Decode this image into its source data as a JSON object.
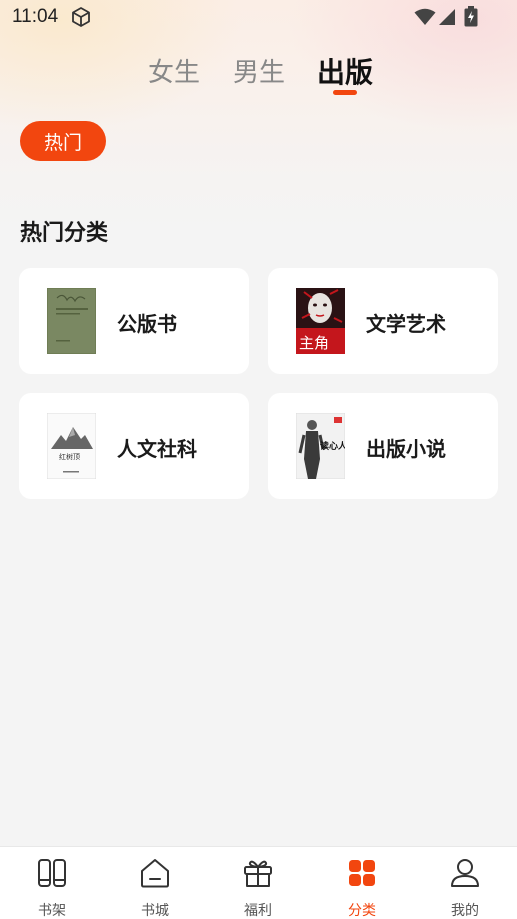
{
  "status_bar": {
    "time": "11:04"
  },
  "tabs": [
    {
      "label": "女生",
      "active": false
    },
    {
      "label": "男生",
      "active": false
    },
    {
      "label": "出版",
      "active": true
    }
  ],
  "filter_chip": {
    "label": "热门"
  },
  "section": {
    "title": "热门分类",
    "categories": [
      {
        "label": "公版书",
        "cover_icon": "book-cover-green"
      },
      {
        "label": "文学艺术",
        "cover_icon": "book-cover-red-portrait",
        "cover_text": "主角"
      },
      {
        "label": "人文社科",
        "cover_icon": "book-cover-mountain",
        "cover_text": "红树顶"
      },
      {
        "label": "出版小说",
        "cover_icon": "book-cover-figure",
        "cover_text": "读心人"
      }
    ]
  },
  "bottom_nav": [
    {
      "label": "书架",
      "icon": "bookshelf-icon",
      "active": false
    },
    {
      "label": "书城",
      "icon": "home-icon",
      "active": false
    },
    {
      "label": "福利",
      "icon": "gift-icon",
      "active": false
    },
    {
      "label": "分类",
      "icon": "grid-icon",
      "active": true
    },
    {
      "label": "我的",
      "icon": "user-icon",
      "active": false
    }
  ],
  "colors": {
    "accent": "#f2460f",
    "background": "#f4f4f4",
    "card": "#ffffff"
  }
}
